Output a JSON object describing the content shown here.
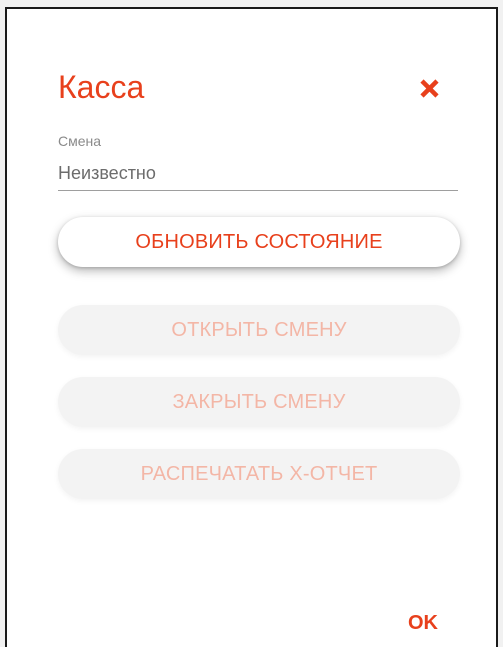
{
  "dialog": {
    "title": "Касса",
    "close_icon": "close-icon",
    "shift_field": {
      "label": "Смена",
      "value": "Неизвестно"
    },
    "buttons": [
      {
        "label": "ОБНОВИТЬ СОСТОЯНИЕ",
        "enabled": true
      },
      {
        "label": "ОТКРЫТЬ СМЕНУ",
        "enabled": false
      },
      {
        "label": "ЗАКРЫТЬ СМЕНУ",
        "enabled": false
      },
      {
        "label": "РАСПЕЧАТАТЬ X-ОТЧЕТ",
        "enabled": false
      }
    ],
    "ok_label": "OK"
  },
  "colors": {
    "accent": "#e8401c",
    "disabled_text": "#f3b6a6",
    "field_text": "#6c6c6c",
    "label_text": "#8a8a8a"
  }
}
